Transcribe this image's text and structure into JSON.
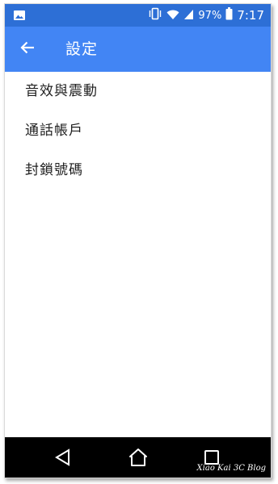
{
  "status_bar": {
    "left_icon": "image-icon",
    "battery_percent": "97%",
    "time": "7:17",
    "icons": [
      "vibrate-icon",
      "wifi-icon",
      "signal-icon",
      "battery-icon"
    ]
  },
  "app_bar": {
    "back_icon": "arrow-back-icon",
    "title": "設定"
  },
  "settings": {
    "items": [
      {
        "label": "音效與震動"
      },
      {
        "label": "通話帳戶"
      },
      {
        "label": "封鎖號碼"
      }
    ]
  },
  "nav_bar": {
    "icons": [
      "nav-back-icon",
      "nav-home-icon",
      "nav-recent-icon"
    ],
    "watermark": "Xiao Kai 3C Blog"
  },
  "colors": {
    "status_bar": "#2d6fd6",
    "app_bar": "#4285f4",
    "nav_bar": "#000000",
    "text": "#212121"
  }
}
